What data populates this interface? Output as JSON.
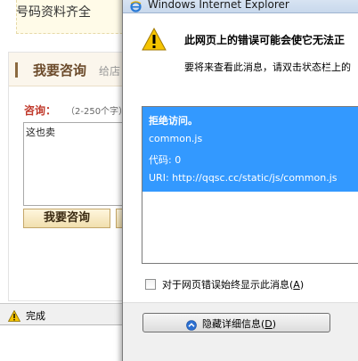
{
  "browser": {
    "phone_box_text": "号码资料齐全",
    "consult": {
      "title": "我要咨询",
      "title_extra": "给店",
      "field_label": "咨询：",
      "field_hint": "（2-250个字）",
      "textarea_value": "这也卖",
      "submit_label": "我要咨询"
    },
    "status": {
      "icon": "warning-icon",
      "text": "完成"
    }
  },
  "dialog": {
    "title": "Windows Internet Explorer",
    "heading": "此网页上的错误可能会使它无法正",
    "subtext": "要将来查看此消息，请双击状态栏上的",
    "error_lines": [
      "拒绝访问。",
      "common.js",
      "代码: 0",
      "URI: http://qqsc.cc/static/js/common.js"
    ],
    "checkbox_label_prefix": "对于网页错误始终显示此消息(",
    "checkbox_label_accel": "A",
    "checkbox_label_suffix": ")",
    "checkbox_checked": false,
    "hide_button_prefix": "隐藏详细信息(",
    "hide_button_accel": "D",
    "hide_button_suffix": ")"
  },
  "colors": {
    "selection": "#3399ff",
    "consult_title": "#6b4a2a",
    "consult_label": "#c0392b",
    "warning_yellow": "#f5c400"
  }
}
